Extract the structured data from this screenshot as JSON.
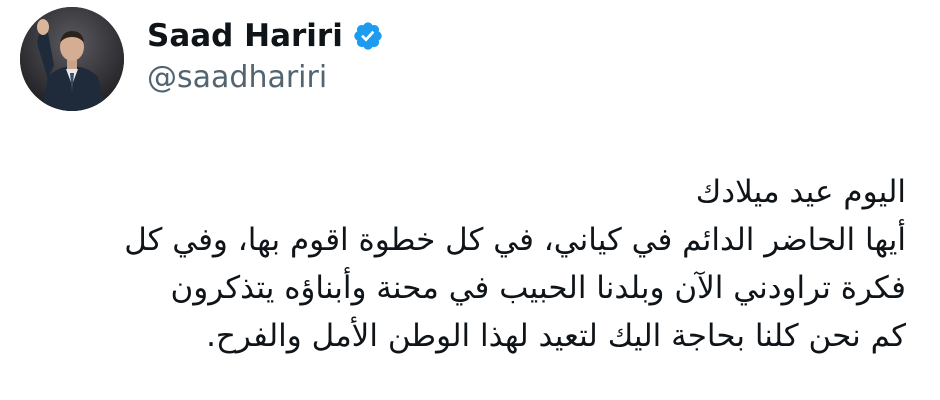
{
  "author": {
    "display_name": "Saad Hariri",
    "handle": "@saadhariri",
    "verified": true,
    "verified_icon": "verified-badge-icon",
    "verified_color": "#1d9bf0",
    "avatar": "profile-photo"
  },
  "tweet": {
    "lines": [
      "اليوم عيد ميلادك",
      "أيها الحاضر الدائم في كياني، في كل خطوة اقوم بها،  وفي كل",
      "فكرة تراودني الآن وبلدنا الحبيب  في محنة وأبناؤه يتذكرون",
      "كم نحن كلنا بحاجة اليك لتعيد لهذا الوطن الأمل والفرح."
    ]
  },
  "colors": {
    "name": "#0f1419",
    "handle": "#536471",
    "text": "#0f1419",
    "background": "#ffffff"
  }
}
